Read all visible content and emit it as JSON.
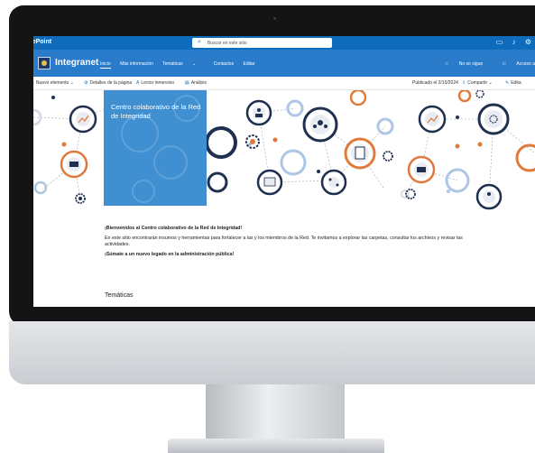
{
  "suite_bar": {
    "brand": "rePoint",
    "search_placeholder": "Buscar en este sitio"
  },
  "site_header": {
    "site_name": "Integranet",
    "nav": [
      "Inicio",
      "Más información",
      "Temáticas",
      "Contactos",
      "Editar"
    ],
    "follow_label": "No se sigue",
    "access_label": "Acceso a"
  },
  "command_bar": {
    "new_item": "Nuevo elemento",
    "page_details": "Detalles de la página",
    "immersive_reader": "Lector inmersivo",
    "analytics": "Análisis",
    "published": "Publicado el 2/10/2024",
    "share": "Compartir",
    "edit": "Edita"
  },
  "hero": {
    "title": "Centro colaborativo de la Red de Integridad"
  },
  "content": {
    "welcome": "¡Bienvenidos al Centro colaborativo de la Red de Integridad!",
    "body": "En este sitio encontrarán insumos y herramientas para fortalecer a las y los miembros de la Red. Te invitamos a explorar las carpetas, consultar los archivos y revisar las actividades.",
    "slogan": "¡Súmate a un nuevo legado en la administración pública!",
    "section_title": "Temáticas"
  },
  "colors": {
    "suite_bar": "#0f6cbd",
    "site_header": "#2a7bc9",
    "hero_box": "#3f8fd1",
    "accent_orange": "#e07a3a",
    "node_navy": "#1f2f4f"
  }
}
